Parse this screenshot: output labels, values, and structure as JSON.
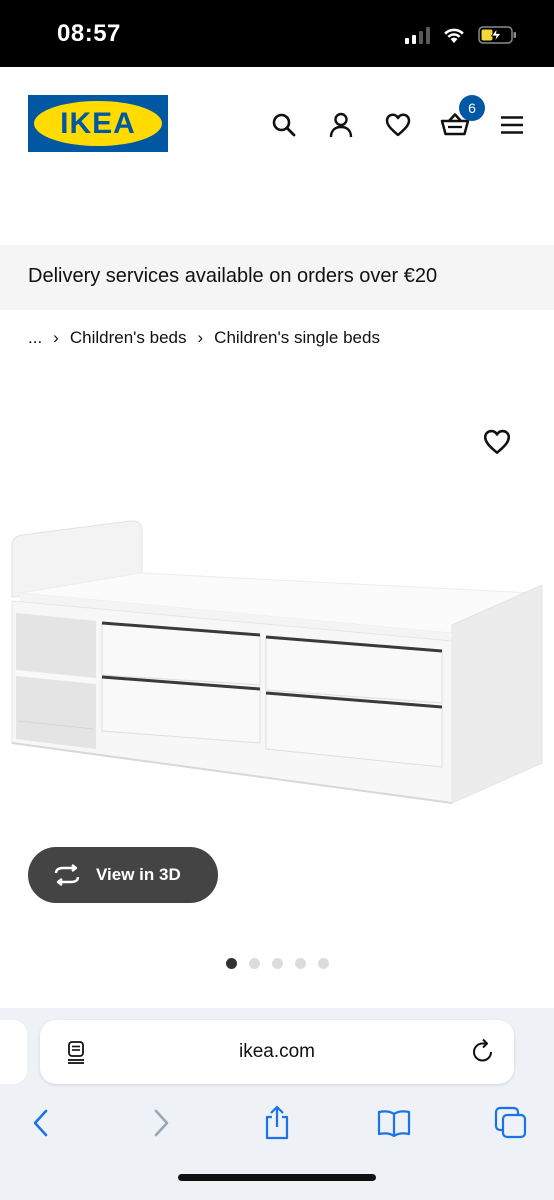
{
  "status_bar": {
    "time": "08:57",
    "icons": [
      "signal-icon",
      "wifi-icon",
      "battery-charging-icon"
    ]
  },
  "header": {
    "logo_text": "IKEA",
    "brand_colors": {
      "blue": "#0058a3",
      "yellow": "#ffdb00"
    },
    "icons": [
      "search-icon",
      "account-icon",
      "heart-icon",
      "basket-icon",
      "menu-icon"
    ],
    "cart_count": "6"
  },
  "banner": {
    "text": "Delivery services available on orders over €20"
  },
  "breadcrumb": {
    "items": [
      "...",
      "Children's beds",
      "Children's single beds"
    ]
  },
  "product": {
    "view3d_label": "View in 3D",
    "carousel": {
      "total": 5,
      "active_index": 0
    }
  },
  "browser": {
    "url": "ikea.com",
    "toolbar_icons": [
      "back-icon",
      "forward-icon",
      "share-icon",
      "bookmarks-icon",
      "tabs-icon"
    ]
  }
}
